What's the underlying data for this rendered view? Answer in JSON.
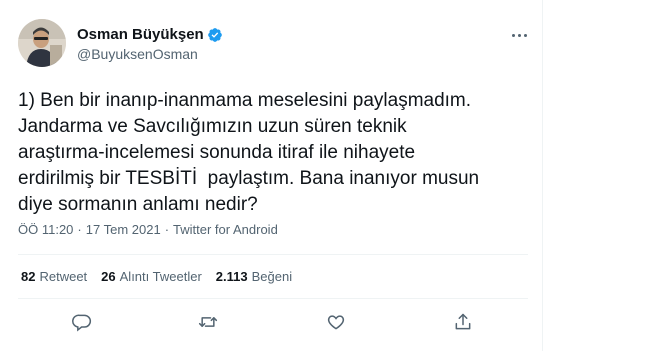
{
  "author": {
    "name": "Osman Büyükşen",
    "handle": "@BuyuksenOsman",
    "verified_color": "#1d9bf0"
  },
  "tweet": {
    "text": "1) Ben bir inanıp-inanmama meselesini paylaşmadım.\nJandarma ve Savcılığımızın uzun süren teknik\naraştırma-incelemesi sonunda itiraf ile nihayete\nerdirilmiş bir TESBİTİ  paylaştım. Bana inanıyor musun\ndiye sormanın anlamı nedir?",
    "time": "ÖÖ 11:20",
    "separator": "·",
    "date": "17 Tem 2021",
    "source": "Twitter for Android"
  },
  "stats": {
    "retweets_count": "82",
    "retweets_label": "Retweet",
    "quotes_count": "26",
    "quotes_label": "Alıntı Tweetler",
    "likes_count": "2.113",
    "likes_label": "Beğeni"
  },
  "icons": {
    "reply": "reply-icon",
    "retweet": "retweet-icon",
    "like": "heart-icon",
    "share": "share-icon",
    "more": "more-icon",
    "verified": "verified-badge-icon"
  },
  "colors": {
    "text": "#0f1419",
    "secondary": "#536471",
    "border": "#eff3f4",
    "accent": "#1d9bf0"
  }
}
